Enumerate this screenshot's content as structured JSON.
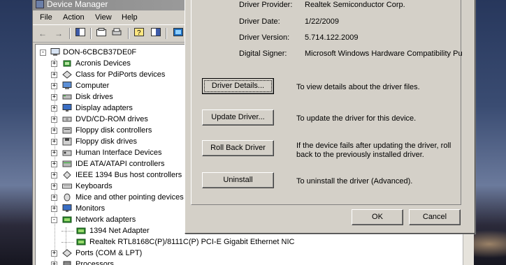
{
  "device_manager": {
    "title": "Device Manager",
    "menu": [
      "File",
      "Action",
      "View",
      "Help"
    ],
    "toolbar_icons": [
      "back-arrow-icon",
      "forward-arrow-icon",
      "console-tree-icon",
      "properties-icon",
      "print-icon",
      "help-icon",
      "show-hide-icon",
      "scan-hardware-icon"
    ],
    "tree": {
      "root": "DON-6CBCB37DE0F",
      "categories": [
        {
          "label": "Acronis Devices",
          "icon": "chip-icon"
        },
        {
          "label": "Class for PdiPorts devices",
          "icon": "port-icon"
        },
        {
          "label": "Computer",
          "icon": "computer-icon"
        },
        {
          "label": "Disk drives",
          "icon": "disk-icon"
        },
        {
          "label": "Display adapters",
          "icon": "monitor-icon"
        },
        {
          "label": "DVD/CD-ROM drives",
          "icon": "cd-icon"
        },
        {
          "label": "Floppy disk controllers",
          "icon": "controller-icon"
        },
        {
          "label": "Floppy disk drives",
          "icon": "floppy-icon"
        },
        {
          "label": "Human Interface Devices",
          "icon": "hid-icon"
        },
        {
          "label": "IDE ATA/ATAPI controllers",
          "icon": "ide-icon"
        },
        {
          "label": "IEEE 1394 Bus host controllers",
          "icon": "firewire-icon"
        },
        {
          "label": "Keyboards",
          "icon": "keyboard-icon"
        },
        {
          "label": "Mice and other pointing devices",
          "icon": "mouse-icon"
        },
        {
          "label": "Monitors",
          "icon": "monitor-icon"
        },
        {
          "label": "Network adapters",
          "icon": "network-icon",
          "expanded": true
        },
        {
          "label": "Ports (COM & LPT)",
          "icon": "port-icon"
        },
        {
          "label": "Processors",
          "icon": "processor-icon"
        }
      ],
      "network_children": [
        "1394 Net Adapter",
        "Realtek RTL8168C(P)/8111C(P) PCI-E Gigabit Ethernet NIC"
      ]
    }
  },
  "properties": {
    "fields": [
      {
        "label": "Driver Provider:",
        "value": "Realtek Semiconductor Corp."
      },
      {
        "label": "Driver Date:",
        "value": "1/22/2009"
      },
      {
        "label": "Driver Version:",
        "value": "5.714.122.2009"
      },
      {
        "label": "Digital Signer:",
        "value": "Microsoft Windows Hardware Compatibility Publ"
      }
    ],
    "actions": [
      {
        "button": "Driver Details...",
        "description": "To view details about the driver files."
      },
      {
        "button": "Update Driver...",
        "description": "To update the driver for this device."
      },
      {
        "button": "Roll Back Driver",
        "description": "If the device fails after updating the driver, roll back to the previously installed driver."
      },
      {
        "button": "Uninstall",
        "description": "To uninstall the driver (Advanced)."
      }
    ],
    "ok_label": "OK",
    "cancel_label": "Cancel"
  },
  "colors": {
    "dialog_face": "#d4d0c8",
    "network_icon": "#2f8a2f"
  }
}
